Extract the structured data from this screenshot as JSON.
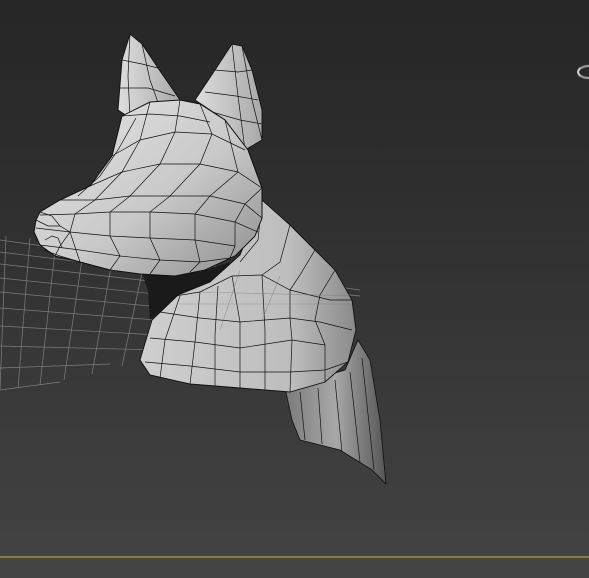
{
  "viewport": {
    "background_top": "#262626",
    "background_bottom": "#444444",
    "grid_color": "#8a8a8a",
    "mesh_fill": "#c8c8c8",
    "mesh_wire": "#111111",
    "timeline_color": "#8e7a3c"
  },
  "icons": {
    "viewcube": "viewcube-ring-icon"
  }
}
